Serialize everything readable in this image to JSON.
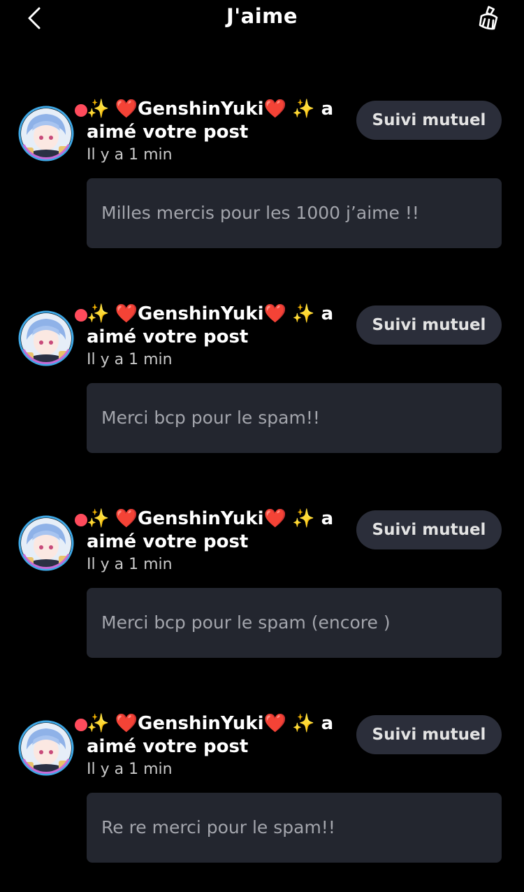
{
  "header": {
    "title": "J'aime",
    "back_icon": "chevron-left-icon",
    "clear_icon": "broom-icon"
  },
  "colors": {
    "background": "#000000",
    "button_bg": "#2b2e3a",
    "comment_bg": "#23262f",
    "badge": "#ff4b5c",
    "muted_text": "#a3a5ac"
  },
  "notifications": [
    {
      "prefix": "✨ ",
      "heart": "❤️",
      "username": "GenshinYuki",
      "suffix": " ✨",
      "action_word": " a",
      "action_rest": "aimé votre post",
      "time": "Il y a 1 min",
      "button": "Suivi mutuel",
      "comment": "Milles mercis pour les 1000 j’aime !!"
    },
    {
      "prefix": "✨ ",
      "heart": "❤️",
      "username": "GenshinYuki",
      "suffix": " ✨",
      "action_word": " a",
      "action_rest": "aimé votre post",
      "time": "Il y a 1 min",
      "button": "Suivi mutuel",
      "comment": "Merci bcp pour le spam!!"
    },
    {
      "prefix": "✨ ",
      "heart": "❤️",
      "username": "GenshinYuki",
      "suffix": " ✨",
      "action_word": " a",
      "action_rest": "aimé votre post",
      "time": "Il y a 1 min",
      "button": "Suivi mutuel",
      "comment": "Merci bcp pour le spam (encore )"
    },
    {
      "prefix": "✨ ",
      "heart": "❤️",
      "username": "GenshinYuki",
      "suffix": " ✨",
      "action_word": " a",
      "action_rest": "aimé votre post",
      "time": "Il y a 1 min",
      "button": "Suivi mutuel",
      "comment": "Re re merci pour le spam!!"
    }
  ]
}
